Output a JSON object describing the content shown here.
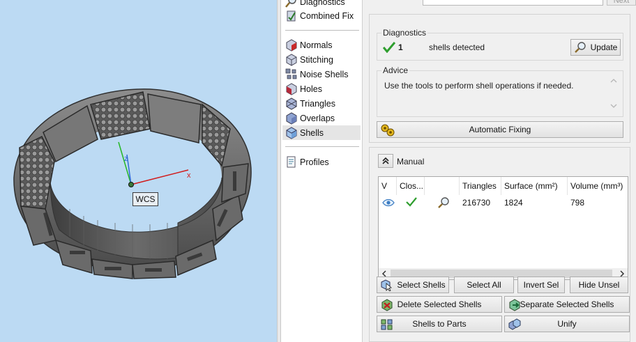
{
  "viewport": {
    "wcs_label": "WCS",
    "axis_x": "x",
    "axis_z": "z"
  },
  "nav": {
    "items": [
      {
        "label": "Diagnostics",
        "icon": "magnifier-icon"
      },
      {
        "label": "Combined Fix",
        "icon": "combined-fix-icon"
      },
      {
        "label": "Normals",
        "icon": "normals-cube-icon"
      },
      {
        "label": "Stitching",
        "icon": "stitching-cube-icon"
      },
      {
        "label": "Noise Shells",
        "icon": "noise-shells-icon"
      },
      {
        "label": "Holes",
        "icon": "holes-cube-icon"
      },
      {
        "label": "Triangles",
        "icon": "triangles-icon"
      },
      {
        "label": "Overlaps",
        "icon": "overlaps-cube-icon"
      },
      {
        "label": "Shells",
        "icon": "shells-cube-icon"
      },
      {
        "label": "Profiles",
        "icon": "profiles-doc-icon"
      }
    ],
    "selected": "Shells"
  },
  "top": {
    "select_value": "",
    "next_label": "Next"
  },
  "diagnostics": {
    "title": "Diagnostics",
    "count": "1",
    "text": "shells detected",
    "update_label": "Update"
  },
  "advice": {
    "title": "Advice",
    "text": "Use the tools to perform shell operations if needed."
  },
  "automatic_fixing_label": "Automatic Fixing",
  "manual": {
    "title": "Manual",
    "columns": [
      "V",
      "Clos...",
      "",
      "Triangles",
      "Surface (mm²)",
      "Volume (mm³)"
    ],
    "rows": [
      {
        "triangles": "216730",
        "surface": "1824",
        "volume": "798"
      }
    ]
  },
  "buttons": {
    "select_shells": "Select Shells",
    "select_all": "Select All",
    "invert_sel": "Invert Sel",
    "hide_unsel": "Hide Unsel",
    "delete_selected": "Delete Selected Shells",
    "separate_selected": "Separate Selected Shells",
    "shells_to_parts": "Shells to Parts",
    "unify": "Unify"
  },
  "colors": {
    "viewport_bg": "#bcdaf3",
    "check_green": "#2e9e2e",
    "axis_x": "#d11b1b",
    "axis_y": "#25b825",
    "axis_z": "#2f6bd6"
  }
}
